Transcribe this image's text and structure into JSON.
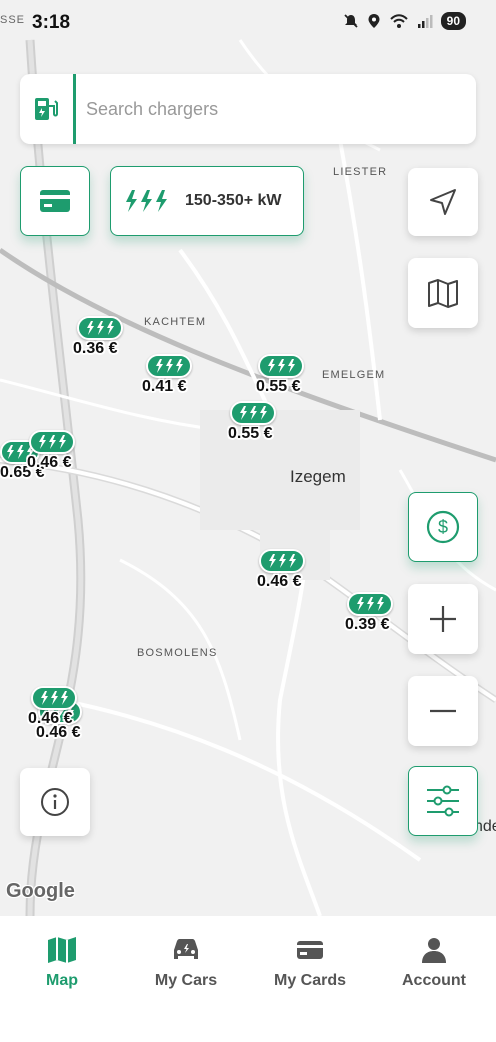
{
  "status_bar": {
    "time": "3:18",
    "left_text": "SSE",
    "battery": "90"
  },
  "search": {
    "placeholder": "Search chargers"
  },
  "power_filter": {
    "label": "150-350+ kW"
  },
  "map": {
    "labels": {
      "liester": "LIESTER",
      "kachtem": "KACHTEM",
      "emelgem": "EMELGEM",
      "bosmolens": "BOSMOLENS",
      "izegem": "Izegem",
      "edge_text": "nde"
    },
    "markers": [
      {
        "price": "0.36 €"
      },
      {
        "price": "0.41 €"
      },
      {
        "price": "0.55 €"
      },
      {
        "price": "0.55 €"
      },
      {
        "price": "0.65 €"
      },
      {
        "price": "0.46 €"
      },
      {
        "price": "0.46 €"
      },
      {
        "price": "0.39 €"
      },
      {
        "price": "0.46 €"
      },
      {
        "price": "0.46 €"
      }
    ],
    "attribution": "Google"
  },
  "tabs": [
    {
      "label": "Map",
      "icon": "map-icon",
      "active": true
    },
    {
      "label": "My Cars",
      "icon": "car-icon",
      "active": false
    },
    {
      "label": "My Cards",
      "icon": "card-icon",
      "active": false
    },
    {
      "label": "Account",
      "icon": "person-icon",
      "active": false
    }
  ],
  "colors": {
    "brand": "#1e9c6e",
    "map_bg": "#f1f1f1"
  }
}
